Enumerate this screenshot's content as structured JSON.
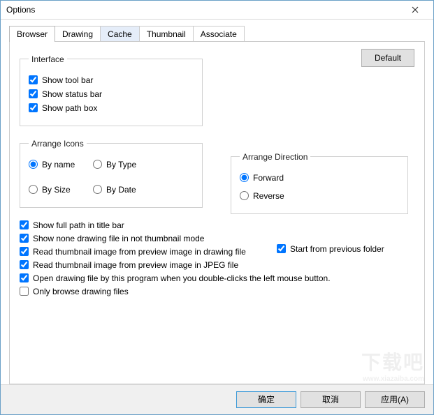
{
  "window": {
    "title": "Options"
  },
  "tabs": {
    "browser": "Browser",
    "drawing": "Drawing",
    "cache": "Cache",
    "thumbnail": "Thumbnail",
    "associate": "Associate"
  },
  "buttons": {
    "default": "Default",
    "ok": "确定",
    "cancel": "取消",
    "apply": "应用(A)"
  },
  "groups": {
    "interface": {
      "legend": "Interface",
      "show_toolbar": "Show tool bar",
      "show_statusbar": "Show status bar",
      "show_pathbox": "Show path box"
    },
    "arrange_icons": {
      "legend": "Arrange Icons",
      "by_name": "By name",
      "by_type": "By Type",
      "by_size": "By Size",
      "by_date": "By Date"
    },
    "arrange_dir": {
      "legend": "Arrange Direction",
      "forward": "Forward",
      "reverse": "Reverse"
    }
  },
  "checks": {
    "full_path": "Show full path in title bar",
    "start_prev": "Start from previous folder",
    "none_drawing": "Show none drawing file in not thumbnail mode",
    "thumb_drawing": "Read thumbnail image from preview image in drawing file",
    "thumb_jpeg": "Read thumbnail image from preview image in JPEG file",
    "open_dblclick": "Open drawing file by this program when you double-clicks the left mouse button.",
    "only_drawing": "Only browse drawing files"
  },
  "state": {
    "interface": {
      "toolbar": true,
      "statusbar": true,
      "pathbox": true
    },
    "arrange_icons": "by_name",
    "arrange_dir": "forward",
    "lower": {
      "full_path": true,
      "start_prev": true,
      "none_drawing": true,
      "thumb_drawing": true,
      "thumb_jpeg": true,
      "open_dblclick": true,
      "only_drawing": false
    }
  }
}
